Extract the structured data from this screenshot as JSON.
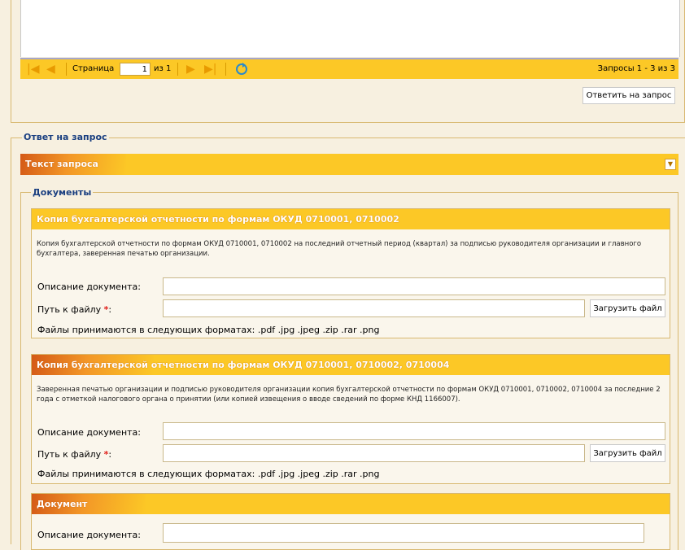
{
  "pager": {
    "page_label": "Страница",
    "page_value": "1",
    "of_label": "из 1",
    "records_label": "Запросы 1 - 3 из 3"
  },
  "reply_button": "Ответить на запрос",
  "answer_section": {
    "legend": "Ответ на запрос",
    "request_text_bar": "Текст запроса"
  },
  "documents": {
    "legend": "Документы",
    "items": [
      {
        "title": "Копия бухгалтерской отчетности по формам ОКУД 0710001, 0710002",
        "description": "Копия бухгалтерской отчетности по формам ОКУД 0710001, 0710002 на последний отчетный период (квартал) за подписью руководителя организации и главного бухгалтера, заверенная печатью организации.",
        "desc_label": "Описание документа:",
        "path_label": "Путь к файлу",
        "upload_button": "Загрузить файл",
        "formats_note": "Файлы принимаются в следующих форматах: .pdf .jpg .jpeg .zip .rar .png"
      },
      {
        "title": "Копия бухгалтерской отчетности по формам ОКУД 0710001, 0710002, 0710004",
        "description": "Заверенная печатью организации и подписью руководителя организации копия бухгалтерской отчетности по формам ОКУД 0710001, 0710002, 0710004 за последние 2 года с отметкой налогового органа о принятии (или копией извещения о вводе сведений по форме КНД 1166007).",
        "desc_label": "Описание документа:",
        "path_label": "Путь к файлу",
        "upload_button": "Загрузить файл",
        "formats_note": "Файлы принимаются в следующих форматах: .pdf .jpg .jpeg .zip .rar .png"
      },
      {
        "title": "Документ",
        "desc_label": "Описание документа:"
      }
    ]
  },
  "required_mark": "*",
  "colors": {
    "bar": "#fcc826",
    "legend_text": "#1a3f80",
    "required": "#e0201b",
    "page_bg": "#f7f0e0"
  }
}
